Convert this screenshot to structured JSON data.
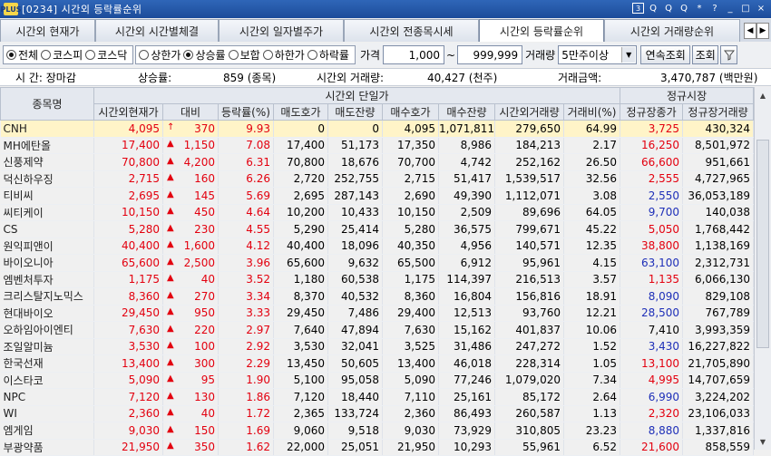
{
  "window": {
    "logo": "PLUS",
    "title": "[0234] 시간외 등락률순위",
    "toolbar_icons": [
      "3",
      "Q",
      "Q",
      "Q",
      "*",
      "?"
    ],
    "controls": [
      "_",
      "□",
      "×"
    ]
  },
  "tabs": [
    {
      "label": "시간외 현재가",
      "active": false
    },
    {
      "label": "시간외 시간별체결",
      "active": false
    },
    {
      "label": "시간외 일자별주가",
      "active": false
    },
    {
      "label": "시간외 전종목시세",
      "active": false
    },
    {
      "label": "시간외 등락률순위",
      "active": true
    },
    {
      "label": "시간외 거래량순위",
      "active": false
    }
  ],
  "tab_nav": {
    "prev": "◀",
    "next": "▶"
  },
  "filters": {
    "market": [
      {
        "label": "전체",
        "on": true
      },
      {
        "label": "코스피",
        "on": false
      },
      {
        "label": "코스닥",
        "on": false
      }
    ],
    "direction": [
      {
        "label": "상한가",
        "on": false
      },
      {
        "label": "상승률",
        "on": true
      },
      {
        "label": "보합",
        "on": false
      },
      {
        "label": "하한가",
        "on": false
      },
      {
        "label": "하락률",
        "on": false
      }
    ],
    "price_label": "가격",
    "price_min": "1,000",
    "price_sep": "~",
    "price_max": "999,999",
    "volume_label": "거래량",
    "volume_value": "5만주이상",
    "continuous_btn": "연속조회",
    "query_btn": "조회",
    "filter_icon": "funnel-icon"
  },
  "summary": {
    "time_label": "시  간: 장마감",
    "rise_label": "상승률:",
    "rise_value": "859 (종목)",
    "vol_label": "시간외 거래량:",
    "vol_value": "40,427 (천주)",
    "amt_label": "거래금액:",
    "amt_value": "3,470,787 (백만원)"
  },
  "headers": {
    "name": "종목명",
    "group1": "시간외 단일가",
    "group2": "정규시장",
    "cols": [
      "시간외현재가",
      "대비",
      "등락률(%)",
      "매도호가",
      "매도잔량",
      "매수호가",
      "매수잔량",
      "시간외거래량",
      "거래비(%)",
      "정규장종가",
      "정규장거래량"
    ]
  },
  "rows": [
    {
      "name": "CNH",
      "price": "4,095",
      "arrow": "↑",
      "chg": "370",
      "rate": "9.93",
      "ask": "0",
      "askq": "0",
      "bid": "4,095",
      "bidq": "1,071,811",
      "vol": "279,650",
      "ratio": "64.99",
      "close": "3,725",
      "cvol": "430,324",
      "hl": true,
      "cc": "up"
    },
    {
      "name": "MH에탄올",
      "price": "17,400",
      "arrow": "▲",
      "chg": "1,150",
      "rate": "7.08",
      "ask": "17,400",
      "askq": "51,173",
      "bid": "17,350",
      "bidq": "8,986",
      "vol": "184,213",
      "ratio": "2.17",
      "close": "16,250",
      "cvol": "8,501,972",
      "cc": "up"
    },
    {
      "name": "신풍제약",
      "price": "70,800",
      "arrow": "▲",
      "chg": "4,200",
      "rate": "6.31",
      "ask": "70,800",
      "askq": "18,676",
      "bid": "70,700",
      "bidq": "4,742",
      "vol": "252,162",
      "ratio": "26.50",
      "close": "66,600",
      "cvol": "951,661",
      "cc": "up"
    },
    {
      "name": "덕신하우징",
      "price": "2,715",
      "arrow": "▲",
      "chg": "160",
      "rate": "6.26",
      "ask": "2,720",
      "askq": "252,755",
      "bid": "2,715",
      "bidq": "51,417",
      "vol": "1,539,517",
      "ratio": "32.56",
      "close": "2,555",
      "cvol": "4,727,965",
      "cc": "up"
    },
    {
      "name": "티비씨",
      "price": "2,695",
      "arrow": "▲",
      "chg": "145",
      "rate": "5.69",
      "ask": "2,695",
      "askq": "287,143",
      "bid": "2,690",
      "bidq": "49,390",
      "vol": "1,112,071",
      "ratio": "3.08",
      "close": "2,550",
      "cvol": "36,053,189",
      "cc": "blue"
    },
    {
      "name": "씨티케이",
      "price": "10,150",
      "arrow": "▲",
      "chg": "450",
      "rate": "4.64",
      "ask": "10,200",
      "askq": "10,433",
      "bid": "10,150",
      "bidq": "2,509",
      "vol": "89,696",
      "ratio": "64.05",
      "close": "9,700",
      "cvol": "140,038",
      "cc": "blue"
    },
    {
      "name": "CS",
      "price": "5,280",
      "arrow": "▲",
      "chg": "230",
      "rate": "4.55",
      "ask": "5,290",
      "askq": "25,414",
      "bid": "5,280",
      "bidq": "36,575",
      "vol": "799,671",
      "ratio": "45.22",
      "close": "5,050",
      "cvol": "1,768,442",
      "cc": "up"
    },
    {
      "name": "원익피앤이",
      "price": "40,400",
      "arrow": "▲",
      "chg": "1,600",
      "rate": "4.12",
      "ask": "40,400",
      "askq": "18,096",
      "bid": "40,350",
      "bidq": "4,956",
      "vol": "140,571",
      "ratio": "12.35",
      "close": "38,800",
      "cvol": "1,138,169",
      "cc": "up"
    },
    {
      "name": "바이오니아",
      "price": "65,600",
      "arrow": "▲",
      "chg": "2,500",
      "rate": "3.96",
      "ask": "65,600",
      "askq": "9,632",
      "bid": "65,500",
      "bidq": "6,912",
      "vol": "95,961",
      "ratio": "4.15",
      "close": "63,100",
      "cvol": "2,312,731",
      "cc": "blue"
    },
    {
      "name": "엠벤처투자",
      "price": "1,175",
      "arrow": "▲",
      "chg": "40",
      "rate": "3.52",
      "ask": "1,180",
      "askq": "60,538",
      "bid": "1,175",
      "bidq": "114,397",
      "vol": "216,513",
      "ratio": "3.57",
      "close": "1,135",
      "cvol": "6,066,130",
      "cc": "up"
    },
    {
      "name": "크리스탈지노믹스",
      "price": "8,360",
      "arrow": "▲",
      "chg": "270",
      "rate": "3.34",
      "ask": "8,370",
      "askq": "40,532",
      "bid": "8,360",
      "bidq": "16,804",
      "vol": "156,816",
      "ratio": "18.91",
      "close": "8,090",
      "cvol": "829,108",
      "cc": "blue"
    },
    {
      "name": "현대바이오",
      "price": "29,450",
      "arrow": "▲",
      "chg": "950",
      "rate": "3.33",
      "ask": "29,450",
      "askq": "7,486",
      "bid": "29,400",
      "bidq": "12,513",
      "vol": "93,760",
      "ratio": "12.21",
      "close": "28,500",
      "cvol": "767,789",
      "cc": "blue"
    },
    {
      "name": "오하임아이엔티",
      "price": "7,630",
      "arrow": "▲",
      "chg": "220",
      "rate": "2.97",
      "ask": "7,640",
      "askq": "47,894",
      "bid": "7,630",
      "bidq": "15,162",
      "vol": "401,837",
      "ratio": "10.06",
      "close": "7,410",
      "cvol": "3,993,359",
      "cc": "none"
    },
    {
      "name": "조일알미늄",
      "price": "3,530",
      "arrow": "▲",
      "chg": "100",
      "rate": "2.92",
      "ask": "3,530",
      "askq": "32,041",
      "bid": "3,525",
      "bidq": "31,486",
      "vol": "247,272",
      "ratio": "1.52",
      "close": "3,430",
      "cvol": "16,227,822",
      "cc": "blue"
    },
    {
      "name": "한국선재",
      "price": "13,400",
      "arrow": "▲",
      "chg": "300",
      "rate": "2.29",
      "ask": "13,450",
      "askq": "50,605",
      "bid": "13,400",
      "bidq": "46,018",
      "vol": "228,314",
      "ratio": "1.05",
      "close": "13,100",
      "cvol": "21,705,890",
      "cc": "up"
    },
    {
      "name": "이스타코",
      "price": "5,090",
      "arrow": "▲",
      "chg": "95",
      "rate": "1.90",
      "ask": "5,100",
      "askq": "95,058",
      "bid": "5,090",
      "bidq": "77,246",
      "vol": "1,079,020",
      "ratio": "7.34",
      "close": "4,995",
      "cvol": "14,707,659",
      "cc": "up"
    },
    {
      "name": "NPC",
      "price": "7,120",
      "arrow": "▲",
      "chg": "130",
      "rate": "1.86",
      "ask": "7,120",
      "askq": "18,440",
      "bid": "7,110",
      "bidq": "25,161",
      "vol": "85,172",
      "ratio": "2.64",
      "close": "6,990",
      "cvol": "3,224,202",
      "cc": "blue"
    },
    {
      "name": "WI",
      "price": "2,360",
      "arrow": "▲",
      "chg": "40",
      "rate": "1.72",
      "ask": "2,365",
      "askq": "133,724",
      "bid": "2,360",
      "bidq": "86,493",
      "vol": "260,587",
      "ratio": "1.13",
      "close": "2,320",
      "cvol": "23,106,033",
      "cc": "up"
    },
    {
      "name": "엠게임",
      "price": "9,030",
      "arrow": "▲",
      "chg": "150",
      "rate": "1.69",
      "ask": "9,060",
      "askq": "9,518",
      "bid": "9,030",
      "bidq": "73,929",
      "vol": "310,805",
      "ratio": "23.23",
      "close": "8,880",
      "cvol": "1,337,816",
      "cc": "blue"
    },
    {
      "name": "부광약품",
      "price": "21,950",
      "arrow": "▲",
      "chg": "350",
      "rate": "1.62",
      "ask": "22,000",
      "askq": "25,051",
      "bid": "21,950",
      "bidq": "10,293",
      "vol": "55,961",
      "ratio": "6.52",
      "close": "21,600",
      "cvol": "858,559",
      "cc": "up"
    }
  ],
  "scroll": {
    "up": "▲",
    "down": "▼"
  }
}
